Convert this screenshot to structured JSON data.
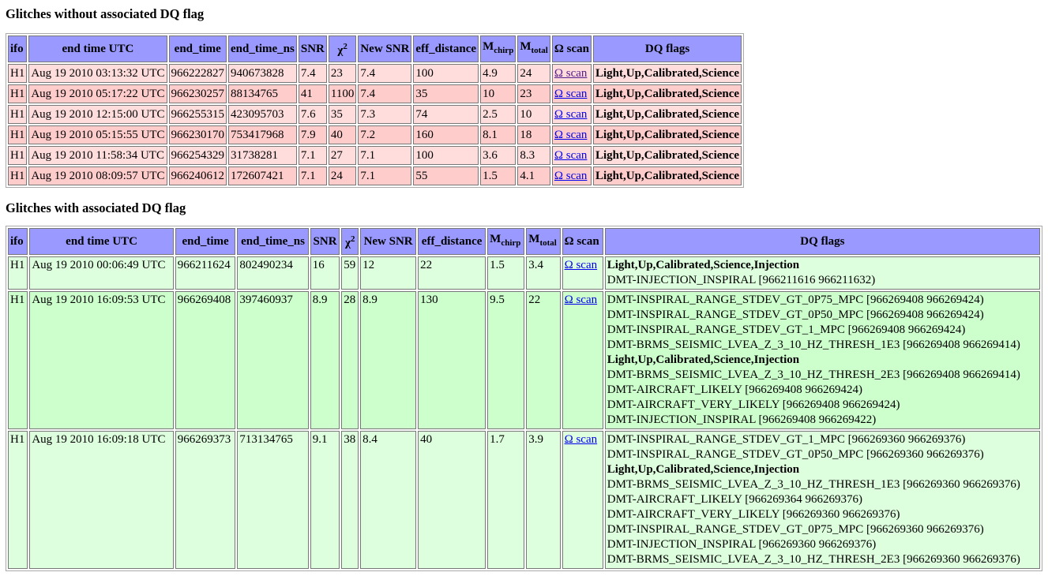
{
  "section1": {
    "title": "Glitches without associated DQ flag",
    "headers": [
      "ifo",
      "end time UTC",
      "end_time",
      "end_time_ns",
      "SNR",
      "χ",
      "New SNR",
      "eff_distance",
      "M",
      "M",
      "Ω scan",
      "DQ flags"
    ],
    "header_sub": {
      "chi_sup": "2",
      "mchirp_sub": "chirp",
      "mtotal_sub": "total"
    },
    "row_colors": [
      "#ffdddd",
      "#ffcccc"
    ],
    "rows": [
      {
        "ifo": "H1",
        "utc": "Aug 19 2010 03:13:32 UTC",
        "end_time": "966222827",
        "ns": "940673828",
        "snr": "7.4",
        "chi2": "23",
        "newsnr": "7.4",
        "dist": "100",
        "mchirp": "4.9",
        "mtotal": "24",
        "scan": "Ω scan",
        "visited": true,
        "flags": [
          {
            "text": "Light,Up,Calibrated,Science",
            "bold": true
          }
        ]
      },
      {
        "ifo": "H1",
        "utc": "Aug 19 2010 05:17:22 UTC",
        "end_time": "966230257",
        "ns": "88134765",
        "snr": "41",
        "chi2": "1100",
        "newsnr": "7.4",
        "dist": "35",
        "mchirp": "10",
        "mtotal": "23",
        "scan": "Ω scan",
        "flags": [
          {
            "text": "Light,Up,Calibrated,Science",
            "bold": true
          }
        ]
      },
      {
        "ifo": "H1",
        "utc": "Aug 19 2010 12:15:00 UTC",
        "end_time": "966255315",
        "ns": "423095703",
        "snr": "7.6",
        "chi2": "35",
        "newsnr": "7.3",
        "dist": "74",
        "mchirp": "2.5",
        "mtotal": "10",
        "scan": "Ω scan",
        "flags": [
          {
            "text": "Light,Up,Calibrated,Science",
            "bold": true
          }
        ]
      },
      {
        "ifo": "H1",
        "utc": "Aug 19 2010 05:15:55 UTC",
        "end_time": "966230170",
        "ns": "753417968",
        "snr": "7.9",
        "chi2": "40",
        "newsnr": "7.2",
        "dist": "160",
        "mchirp": "8.1",
        "mtotal": "18",
        "scan": "Ω scan",
        "flags": [
          {
            "text": "Light,Up,Calibrated,Science",
            "bold": true
          }
        ]
      },
      {
        "ifo": "H1",
        "utc": "Aug 19 2010 11:58:34 UTC",
        "end_time": "966254329",
        "ns": "31738281",
        "snr": "7.1",
        "chi2": "27",
        "newsnr": "7.1",
        "dist": "100",
        "mchirp": "3.6",
        "mtotal": "8.3",
        "scan": "Ω scan",
        "flags": [
          {
            "text": "Light,Up,Calibrated,Science",
            "bold": true
          }
        ]
      },
      {
        "ifo": "H1",
        "utc": "Aug 19 2010 08:09:57 UTC",
        "end_time": "966240612",
        "ns": "172607421",
        "snr": "7.1",
        "chi2": "24",
        "newsnr": "7.1",
        "dist": "55",
        "mchirp": "1.5",
        "mtotal": "4.1",
        "scan": "Ω scan",
        "flags": [
          {
            "text": "Light,Up,Calibrated,Science",
            "bold": true
          }
        ]
      }
    ]
  },
  "section2": {
    "title": "Glitches with associated DQ flag",
    "row_colors": [
      "#ddffdd",
      "#ccffcc"
    ],
    "rows": [
      {
        "ifo": "H1",
        "utc": "Aug 19 2010 00:06:49 UTC",
        "end_time": "966211624",
        "ns": "802490234",
        "snr": "16",
        "chi2": "59",
        "newsnr": "12",
        "dist": "22",
        "mchirp": "1.5",
        "mtotal": "3.4",
        "scan": "Ω scan",
        "flags": [
          {
            "text": "Light,Up,Calibrated,Science,Injection",
            "bold": true
          },
          {
            "text": "DMT-INJECTION_INSPIRAL [966211616 966211632)",
            "bold": false
          }
        ]
      },
      {
        "ifo": "H1",
        "utc": "Aug 19 2010 16:09:53 UTC",
        "end_time": "966269408",
        "ns": "397460937",
        "snr": "8.9",
        "chi2": "28",
        "newsnr": "8.9",
        "dist": "130",
        "mchirp": "9.5",
        "mtotal": "22",
        "scan": "Ω scan",
        "flags": [
          {
            "text": "DMT-INSPIRAL_RANGE_STDEV_GT_0P75_MPC [966269408 966269424)",
            "bold": false
          },
          {
            "text": "DMT-INSPIRAL_RANGE_STDEV_GT_0P50_MPC [966269408 966269424)",
            "bold": false
          },
          {
            "text": "DMT-INSPIRAL_RANGE_STDEV_GT_1_MPC [966269408 966269424)",
            "bold": false
          },
          {
            "text": "DMT-BRMS_SEISMIC_LVEA_Z_3_10_HZ_THRESH_1E3 [966269408 966269414)",
            "bold": false
          },
          {
            "text": "Light,Up,Calibrated,Science,Injection",
            "bold": true
          },
          {
            "text": "DMT-BRMS_SEISMIC_LVEA_Z_3_10_HZ_THRESH_2E3 [966269408 966269414)",
            "bold": false
          },
          {
            "text": "DMT-AIRCRAFT_LIKELY [966269408 966269424)",
            "bold": false
          },
          {
            "text": "DMT-AIRCRAFT_VERY_LIKELY [966269408 966269424)",
            "bold": false
          },
          {
            "text": "DMT-INJECTION_INSPIRAL [966269408 966269422)",
            "bold": false
          }
        ]
      },
      {
        "ifo": "H1",
        "utc": "Aug 19 2010 16:09:18 UTC",
        "end_time": "966269373",
        "ns": "713134765",
        "snr": "9.1",
        "chi2": "38",
        "newsnr": "8.4",
        "dist": "40",
        "mchirp": "1.7",
        "mtotal": "3.9",
        "scan": "Ω scan",
        "flags": [
          {
            "text": "DMT-INSPIRAL_RANGE_STDEV_GT_1_MPC [966269360 966269376)",
            "bold": false
          },
          {
            "text": "DMT-INSPIRAL_RANGE_STDEV_GT_0P50_MPC [966269360 966269376)",
            "bold": false
          },
          {
            "text": "Light,Up,Calibrated,Science,Injection",
            "bold": true
          },
          {
            "text": "DMT-BRMS_SEISMIC_LVEA_Z_3_10_HZ_THRESH_1E3 [966269360 966269376)",
            "bold": false
          },
          {
            "text": "DMT-AIRCRAFT_LIKELY [966269364 966269376)",
            "bold": false
          },
          {
            "text": "DMT-AIRCRAFT_VERY_LIKELY [966269360 966269376)",
            "bold": false
          },
          {
            "text": "DMT-INSPIRAL_RANGE_STDEV_GT_0P75_MPC [966269360 966269376)",
            "bold": false
          },
          {
            "text": "DMT-INJECTION_INSPIRAL [966269360 966269376)",
            "bold": false
          },
          {
            "text": "DMT-BRMS_SEISMIC_LVEA_Z_3_10_HZ_THRESH_2E3 [966269360 966269376)",
            "bold": false
          }
        ]
      }
    ]
  },
  "colors": {
    "header_bg": "#9999ff",
    "link": "#0000ee",
    "visited_link": "#551a8b"
  }
}
